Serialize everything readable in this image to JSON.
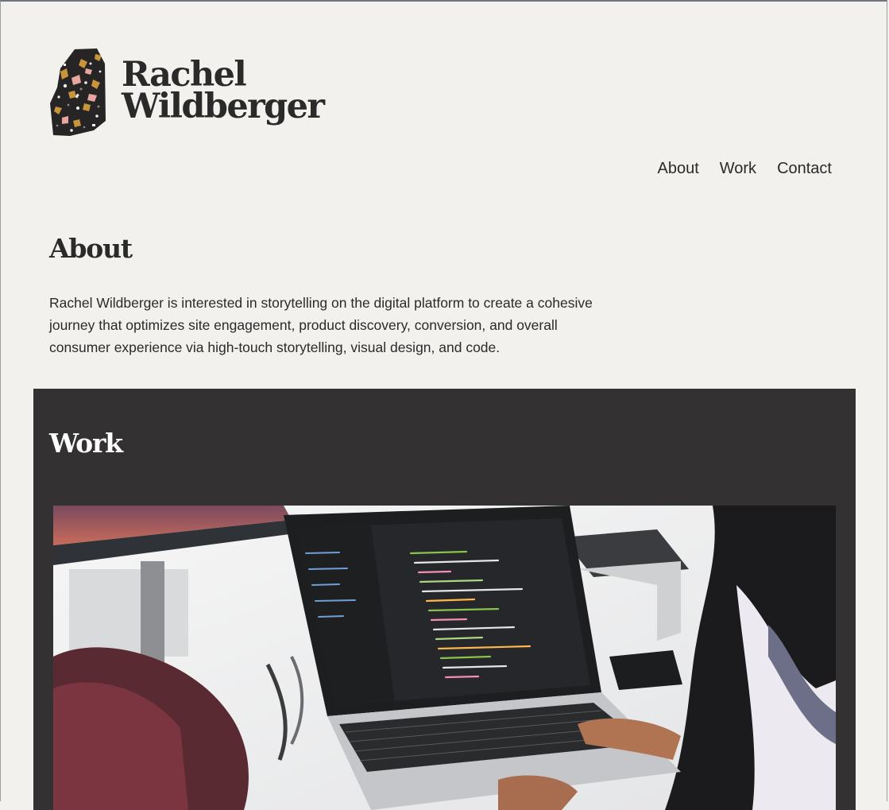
{
  "site": {
    "name_line1": "Rachel",
    "name_line2": "Wildberger"
  },
  "nav": {
    "items": [
      {
        "label": "About"
      },
      {
        "label": "Work"
      },
      {
        "label": "Contact"
      }
    ]
  },
  "about": {
    "heading": "About",
    "body": "Rachel Wildberger is interested in storytelling on the digital platform to create a cohesive journey that optimizes site engagement, product discovery, conversion, and overall consumer experience via high-touch storytelling, visual design, and code."
  },
  "work": {
    "heading": "Work",
    "image_description": "laptop-with-code-photo"
  },
  "colors": {
    "page_background": "#f2f1ee",
    "text": "#2b2a2a",
    "work_background": "#333132",
    "logo_gold": "#c9953a",
    "logo_pink": "#e8a6a0"
  }
}
